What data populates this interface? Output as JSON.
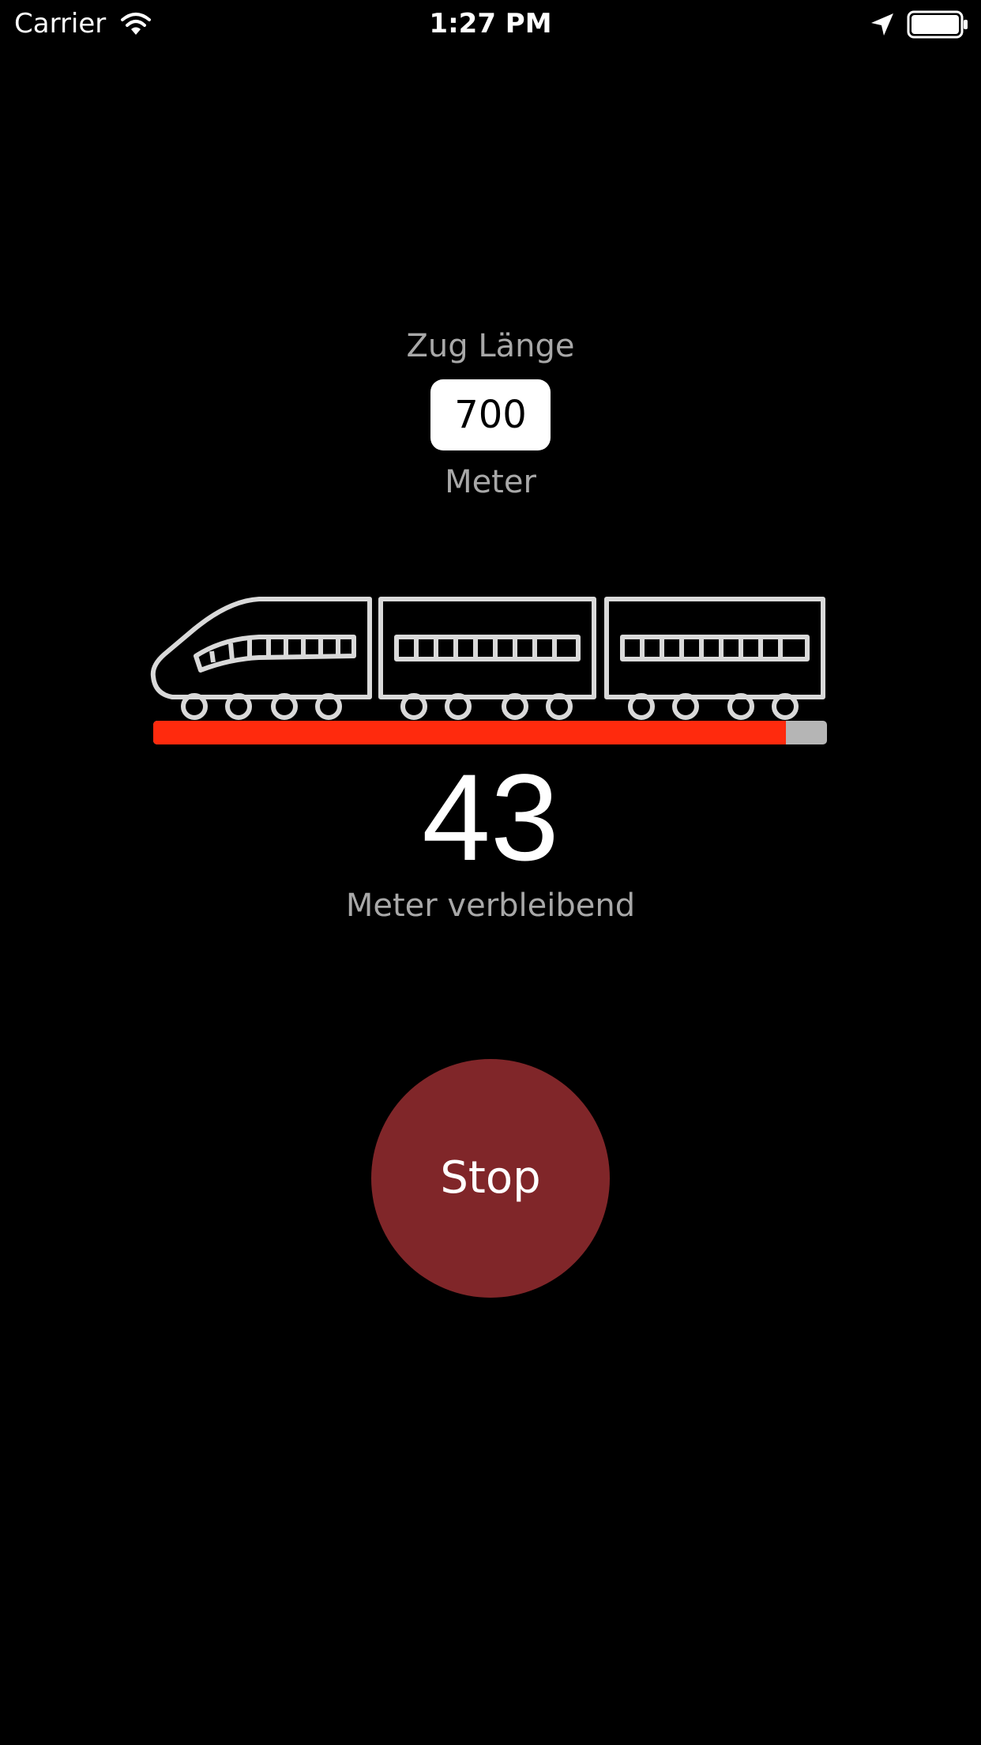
{
  "status_bar": {
    "carrier": "Carrier",
    "time": "1:27 PM",
    "icons": [
      "wifi-icon",
      "location-arrow-icon",
      "battery-icon"
    ]
  },
  "train_length": {
    "label": "Zug Länge",
    "value": "700",
    "unit": "Meter"
  },
  "train_graphic": {
    "icon": "high-speed-train-icon",
    "stroke_color": "#d9d9d9"
  },
  "progress": {
    "fraction": 0.9386,
    "fill_color": "#ff2a0d",
    "track_color": "#b5b5b5"
  },
  "remaining": {
    "value": "43",
    "label": "Meter verbleibend"
  },
  "stop_button": {
    "label": "Stop",
    "color": "#802629"
  },
  "colors": {
    "background": "#000000",
    "secondary_text": "#a8a8a8"
  }
}
